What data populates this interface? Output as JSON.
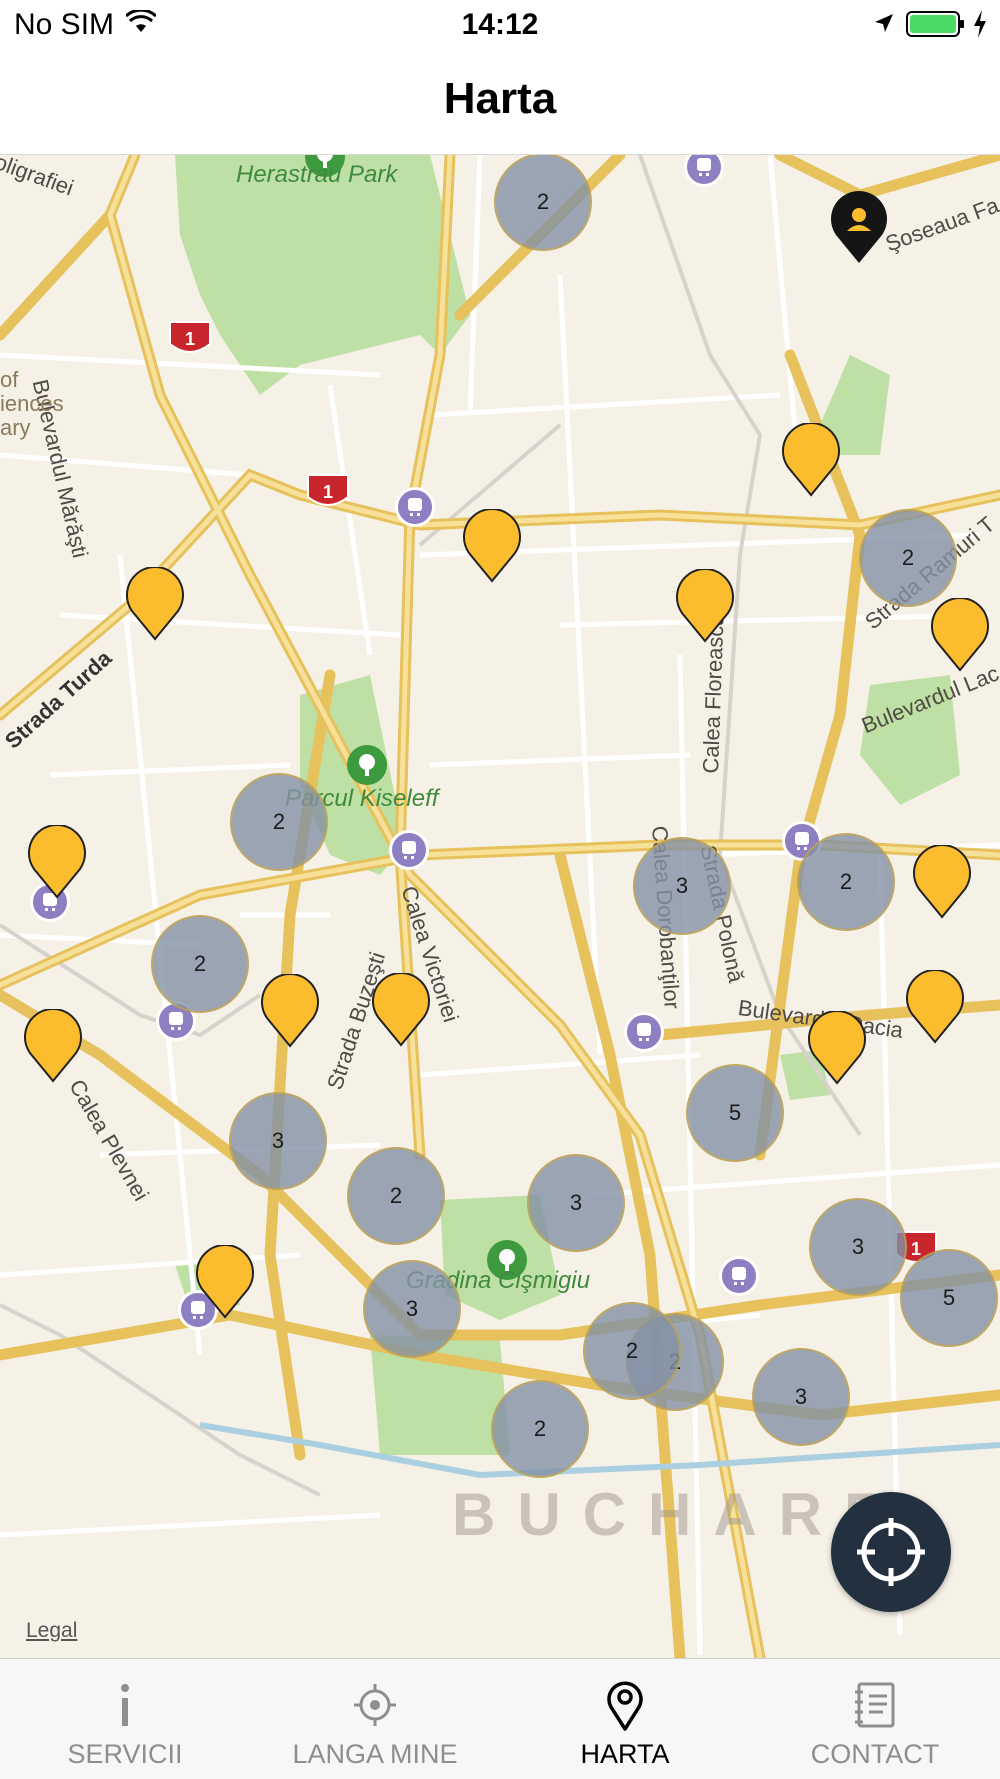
{
  "status_bar": {
    "carrier": "No SIM",
    "time": "14:12"
  },
  "nav": {
    "title": "Harta"
  },
  "map": {
    "watermark": "BUCHARE",
    "legal": "Legal",
    "park_labels": [
      "Herastrau Park",
      "Parcul Kiseleff",
      "Gradina Cişmigiu"
    ],
    "street_labels": [
      "Bulevardul Mărăşti",
      "Strada Turda",
      "Calea Floreasca",
      "Calea Victoriei",
      "Strada Buzeşti",
      "Calea Dorobanţilor",
      "Strada Polonă",
      "Bulevardul Dacia",
      "Calea Plevnei",
      "Şoseaua Fa",
      "Strada Ramuri T",
      "Bulevardul Lac",
      "oligrafiei",
      "of",
      "iences",
      "ary"
    ],
    "highway_number": "1",
    "clusters": [
      "2",
      "2",
      "2",
      "2",
      "3",
      "2",
      "2",
      "5",
      "3",
      "2",
      "3",
      "3",
      "5",
      "3",
      "2",
      "3",
      "2"
    ],
    "pin_count": 13
  },
  "tabs": [
    {
      "label": "SERVICII",
      "icon": "info-icon"
    },
    {
      "label": "LANGA MINE",
      "icon": "crosshair-icon"
    },
    {
      "label": "HARTA",
      "icon": "map-pin-icon",
      "active": true
    },
    {
      "label": "CONTACT",
      "icon": "contact-book-icon"
    }
  ],
  "colors": {
    "accent": "#fbbd2e",
    "cluster": "#8391a5",
    "locate_button": "#233040",
    "active_tab": "#000000",
    "inactive_tab": "#8e8e8e"
  }
}
